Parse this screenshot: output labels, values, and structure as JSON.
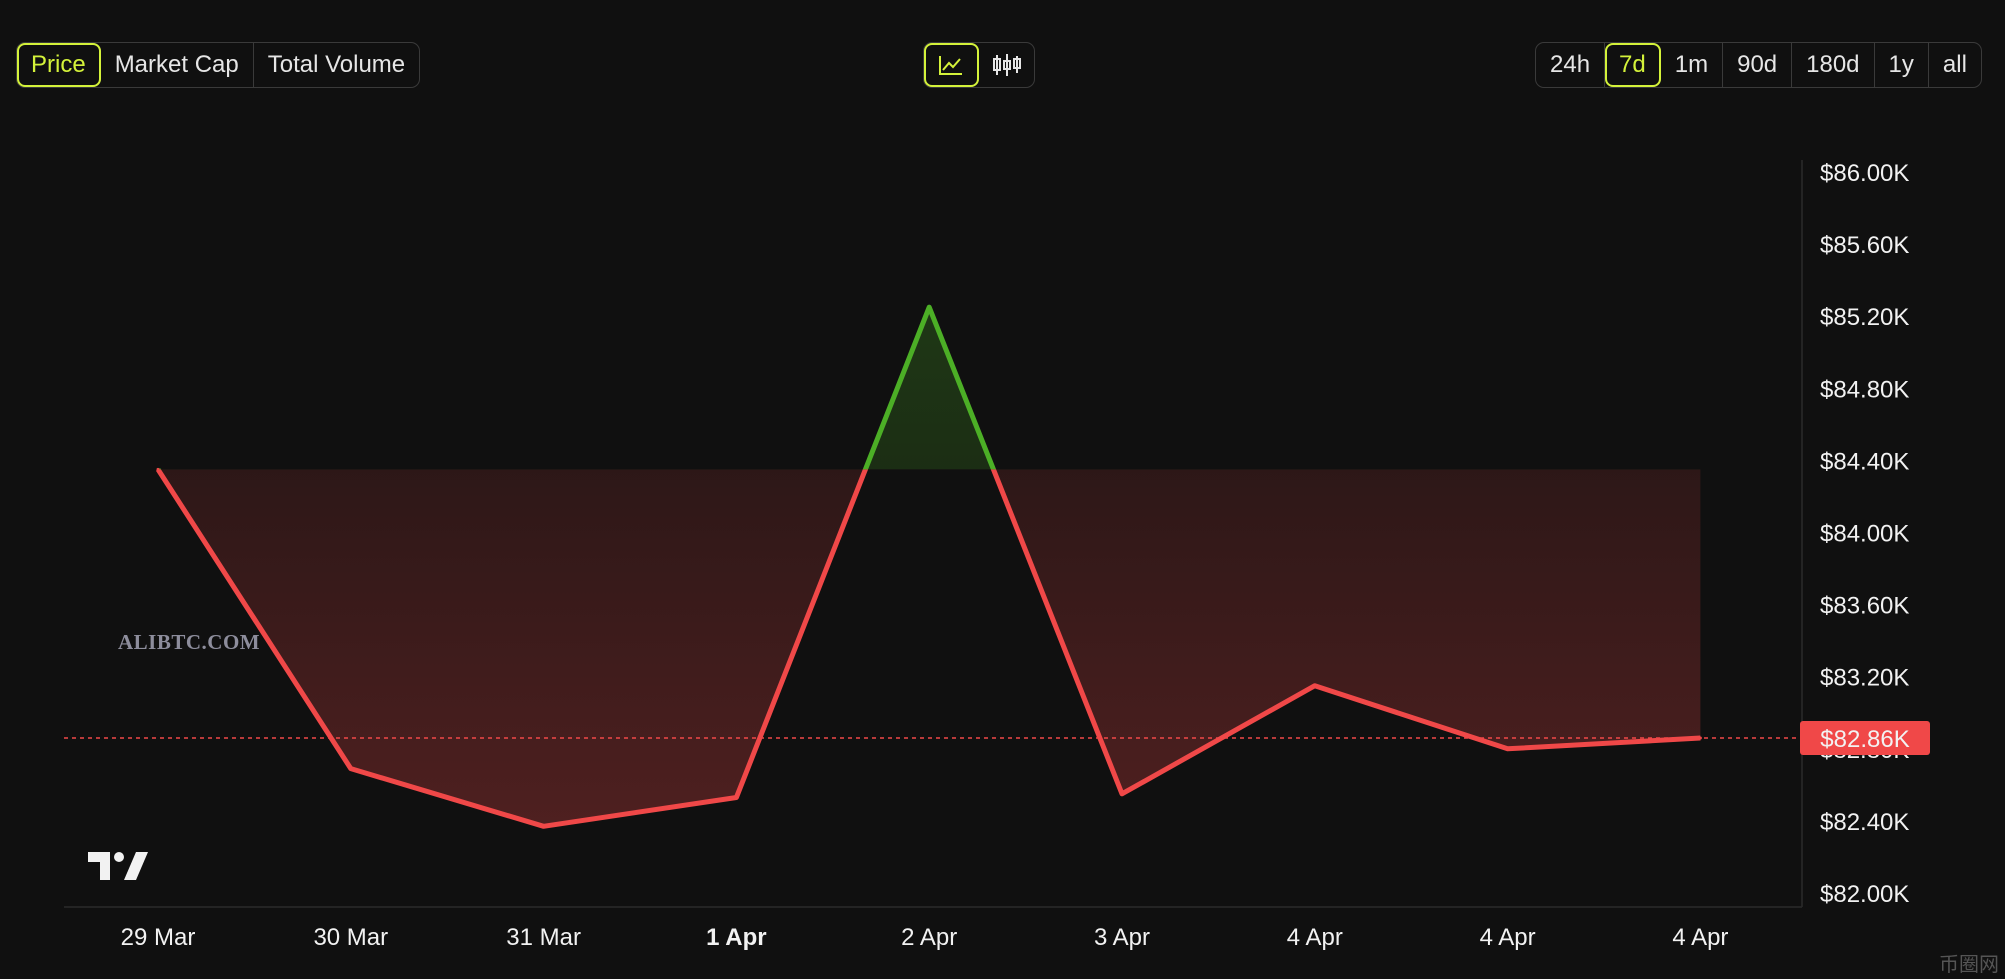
{
  "metric_tabs": [
    {
      "label": "Price",
      "active": true
    },
    {
      "label": "Market Cap",
      "active": false
    },
    {
      "label": "Total Volume",
      "active": false
    }
  ],
  "chart_types": [
    {
      "icon": "line-chart-icon",
      "active": true
    },
    {
      "icon": "candlestick-chart-icon",
      "active": false
    }
  ],
  "range_tabs": [
    {
      "label": "24h",
      "active": false
    },
    {
      "label": "7d",
      "active": true
    },
    {
      "label": "1m",
      "active": false
    },
    {
      "label": "90d",
      "active": false
    },
    {
      "label": "180d",
      "active": false
    },
    {
      "label": "1y",
      "active": false
    },
    {
      "label": "all",
      "active": false
    }
  ],
  "watermark": "ALIBTC.COM",
  "corner_logo": "币圈网",
  "colors": {
    "up": "#4caf26",
    "down": "#f04848",
    "accent": "#d4f23a",
    "price_badge": "#f04848"
  },
  "chart_data": {
    "type": "line",
    "x": [
      "29 Mar",
      "30 Mar",
      "31 Mar",
      "1 Apr",
      "2 Apr",
      "3 Apr",
      "4 Apr",
      "4 Apr",
      "4 Apr"
    ],
    "x_bold": [
      false,
      false,
      false,
      true,
      false,
      false,
      false,
      false,
      false
    ],
    "series": [
      {
        "values": [
          84.35,
          82.69,
          82.37,
          82.53,
          85.25,
          82.55,
          83.15,
          82.8,
          82.86
        ]
      }
    ],
    "baseline": 84.35,
    "current_price": 82.86,
    "current_price_label": "$82.86K",
    "ylim": [
      82.0,
      86.0
    ],
    "y_ticks": [
      "$86.00K",
      "$85.60K",
      "$85.20K",
      "$84.80K",
      "$84.40K",
      "$84.00K",
      "$83.60K",
      "$83.20K",
      "$82.80K",
      "$82.40K",
      "$82.00K"
    ],
    "y_tick_values": [
      86.0,
      85.6,
      85.2,
      84.8,
      84.4,
      84.0,
      83.6,
      83.2,
      82.8,
      82.4,
      82.0
    ],
    "xlabel": "",
    "ylabel": "",
    "title": "",
    "grid": false
  }
}
